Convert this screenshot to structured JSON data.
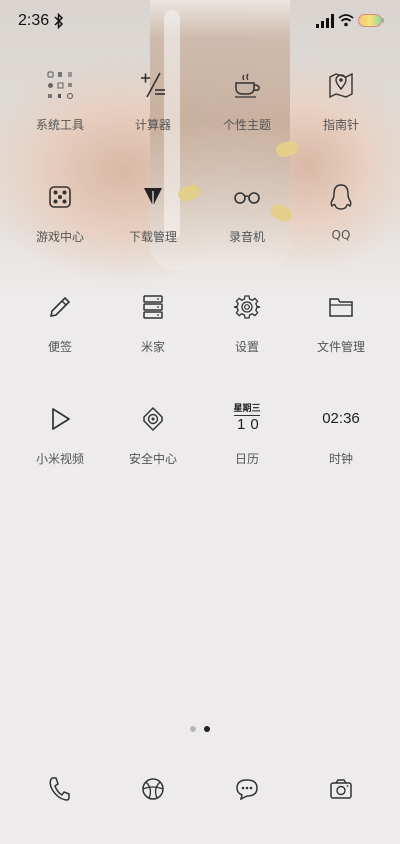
{
  "status_bar": {
    "time": "2:36",
    "icons": [
      "bluetooth-icon",
      "signal-icon",
      "wifi-icon",
      "battery-icon"
    ]
  },
  "apps": {
    "row1": [
      {
        "label": "系统工具",
        "icon": "folder-grid-icon"
      },
      {
        "label": "计算器",
        "icon": "calculator-icon"
      },
      {
        "label": "个性主题",
        "icon": "coffee-cup-icon"
      },
      {
        "label": "指南针",
        "icon": "map-pin-icon"
      }
    ],
    "row2": [
      {
        "label": "游戏中心",
        "icon": "dice-icon"
      },
      {
        "label": "下载管理",
        "icon": "download-arrow-icon"
      },
      {
        "label": "录音机",
        "icon": "glasses-icon"
      },
      {
        "label": "QQ",
        "icon": "penguin-icon"
      }
    ],
    "row3": [
      {
        "label": "便签",
        "icon": "pencil-icon"
      },
      {
        "label": "米家",
        "icon": "server-stack-icon"
      },
      {
        "label": "设置",
        "icon": "gear-icon"
      },
      {
        "label": "文件管理",
        "icon": "folder-icon"
      }
    ],
    "row4": [
      {
        "label": "小米视频",
        "icon": "play-icon"
      },
      {
        "label": "安全中心",
        "icon": "shield-target-icon"
      },
      {
        "label": "日历",
        "icon": "calendar-icon",
        "weekday": "星期三",
        "day": "10"
      },
      {
        "label": "时钟",
        "icon": "clock-icon",
        "time": "02:36"
      }
    ]
  },
  "page_indicator": {
    "total": 2,
    "active": 2
  },
  "dock": [
    {
      "icon": "phone-icon"
    },
    {
      "icon": "browser-ball-icon"
    },
    {
      "icon": "message-bubble-icon"
    },
    {
      "icon": "camera-icon"
    }
  ]
}
